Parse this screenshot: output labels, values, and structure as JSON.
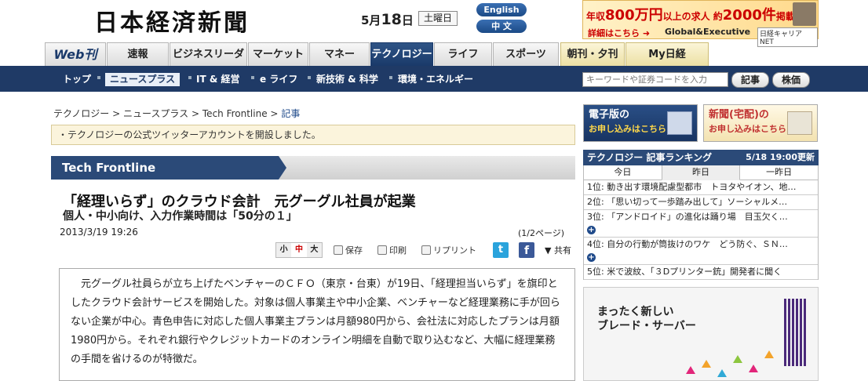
{
  "masthead": {
    "logo": "日本経済新聞",
    "date_day": "5月",
    "date_num": "18",
    "date_suffix": "日",
    "weekday": "土曜日",
    "lang_en": "English",
    "lang_zh": "中 文"
  },
  "top_ad": {
    "line1_prefix": "年収",
    "line1_amount": "800万円",
    "line1_mid": "以上の求人 約",
    "line1_count": "2000件",
    "line1_suffix": "掲載",
    "link": "詳細はこちら ➜",
    "brand": "Global&Executive",
    "tag": "日経キャリアNET"
  },
  "tabs": [
    {
      "label": "Web刊"
    },
    {
      "label": "速報"
    },
    {
      "label": "ビジネスリーダー"
    },
    {
      "label": "マーケット"
    },
    {
      "label": "マネー"
    },
    {
      "label": "テクノロジー"
    },
    {
      "label": "ライフ"
    },
    {
      "label": "スポーツ"
    },
    {
      "label": "朝刊・夕刊"
    },
    {
      "label": "My日経"
    }
  ],
  "subnav": [
    {
      "label": "トップ"
    },
    {
      "label": "ニュースプラス"
    },
    {
      "label": "IT & 経営"
    },
    {
      "label": "e ライフ"
    },
    {
      "label": "新技術 & 科学"
    },
    {
      "label": "環境・エネルギー"
    }
  ],
  "search": {
    "placeholder": "キーワードや証券コードを入力",
    "btn_article": "記事",
    "btn_stock": "株価"
  },
  "breadcrumb": {
    "c1": "テクノロジー",
    "c2": "ニュースプラス",
    "c3": "Tech Frontline",
    "current": "記事",
    "sep": ">"
  },
  "notice": "・テクノロジーの公式ツイッターアカウントを開設しました。",
  "section_title": "Tech Frontline",
  "article": {
    "headline": "「経理いらず」のクラウド会計　元グーグル社員が起業",
    "subhead": "個人・中小向け、入力作業時間は「50分の１」",
    "timestamp": "2013/3/19 19:26",
    "pagecount": "(1/2ページ)",
    "font_small": "小",
    "font_mid": "中",
    "font_large": "大",
    "save": "保存",
    "print": "印刷",
    "reprint": "リプリント",
    "share": "▼ 共有",
    "body": "　元グーグル社員らが立ち上げたベンチャーのＣＦＯ（東京・台東）が19日、「経理担当いらず」を旗印としたクラウド会計サービスを開始した。対象は個人事業主や中小企業、ベンチャーなど経理業務に手が回らない企業が中心。青色申告に対応した個人事業主プランは月額980円から、会社法に対応したプランは月額1980円から。それぞれ銀行やクレジットカードのオンライン明細を自動で取り込むなど、大幅に経理業務の手間を省けるのが特徴だ。"
  },
  "right_ads": {
    "digital_l1": "電子版の",
    "digital_l2": "お申し込みはこちら",
    "paper_l1": "新聞(宅配)の",
    "paper_l2": "お申し込みはこちら"
  },
  "ranking": {
    "title": "テクノロジー 記事ランキング",
    "updated": "5/18 19:00更新",
    "tabs": [
      "今日",
      "昨日",
      "一昨日"
    ],
    "items": [
      {
        "text": "1位: 動き出す環境配慮型都市　トヨタやイオン、地…",
        "plus": false
      },
      {
        "text": "2位: 「思い切って一歩踏み出して」ソーシャルメ…",
        "plus": false
      },
      {
        "text": "3位: 「アンドロイド」の進化は踊り場　目玉欠く…",
        "plus": true
      },
      {
        "text": "4位: 自分の行動が筒抜けのワケ　どう防ぐ、ＳＮ…",
        "plus": true
      },
      {
        "text": "5位: 米で波紋、「３Dプリンター銃」開発者に聞く",
        "plus": false
      }
    ]
  },
  "ibm_ad": {
    "line1": "まったく新しい",
    "line2": "ブレード・サーバー"
  }
}
